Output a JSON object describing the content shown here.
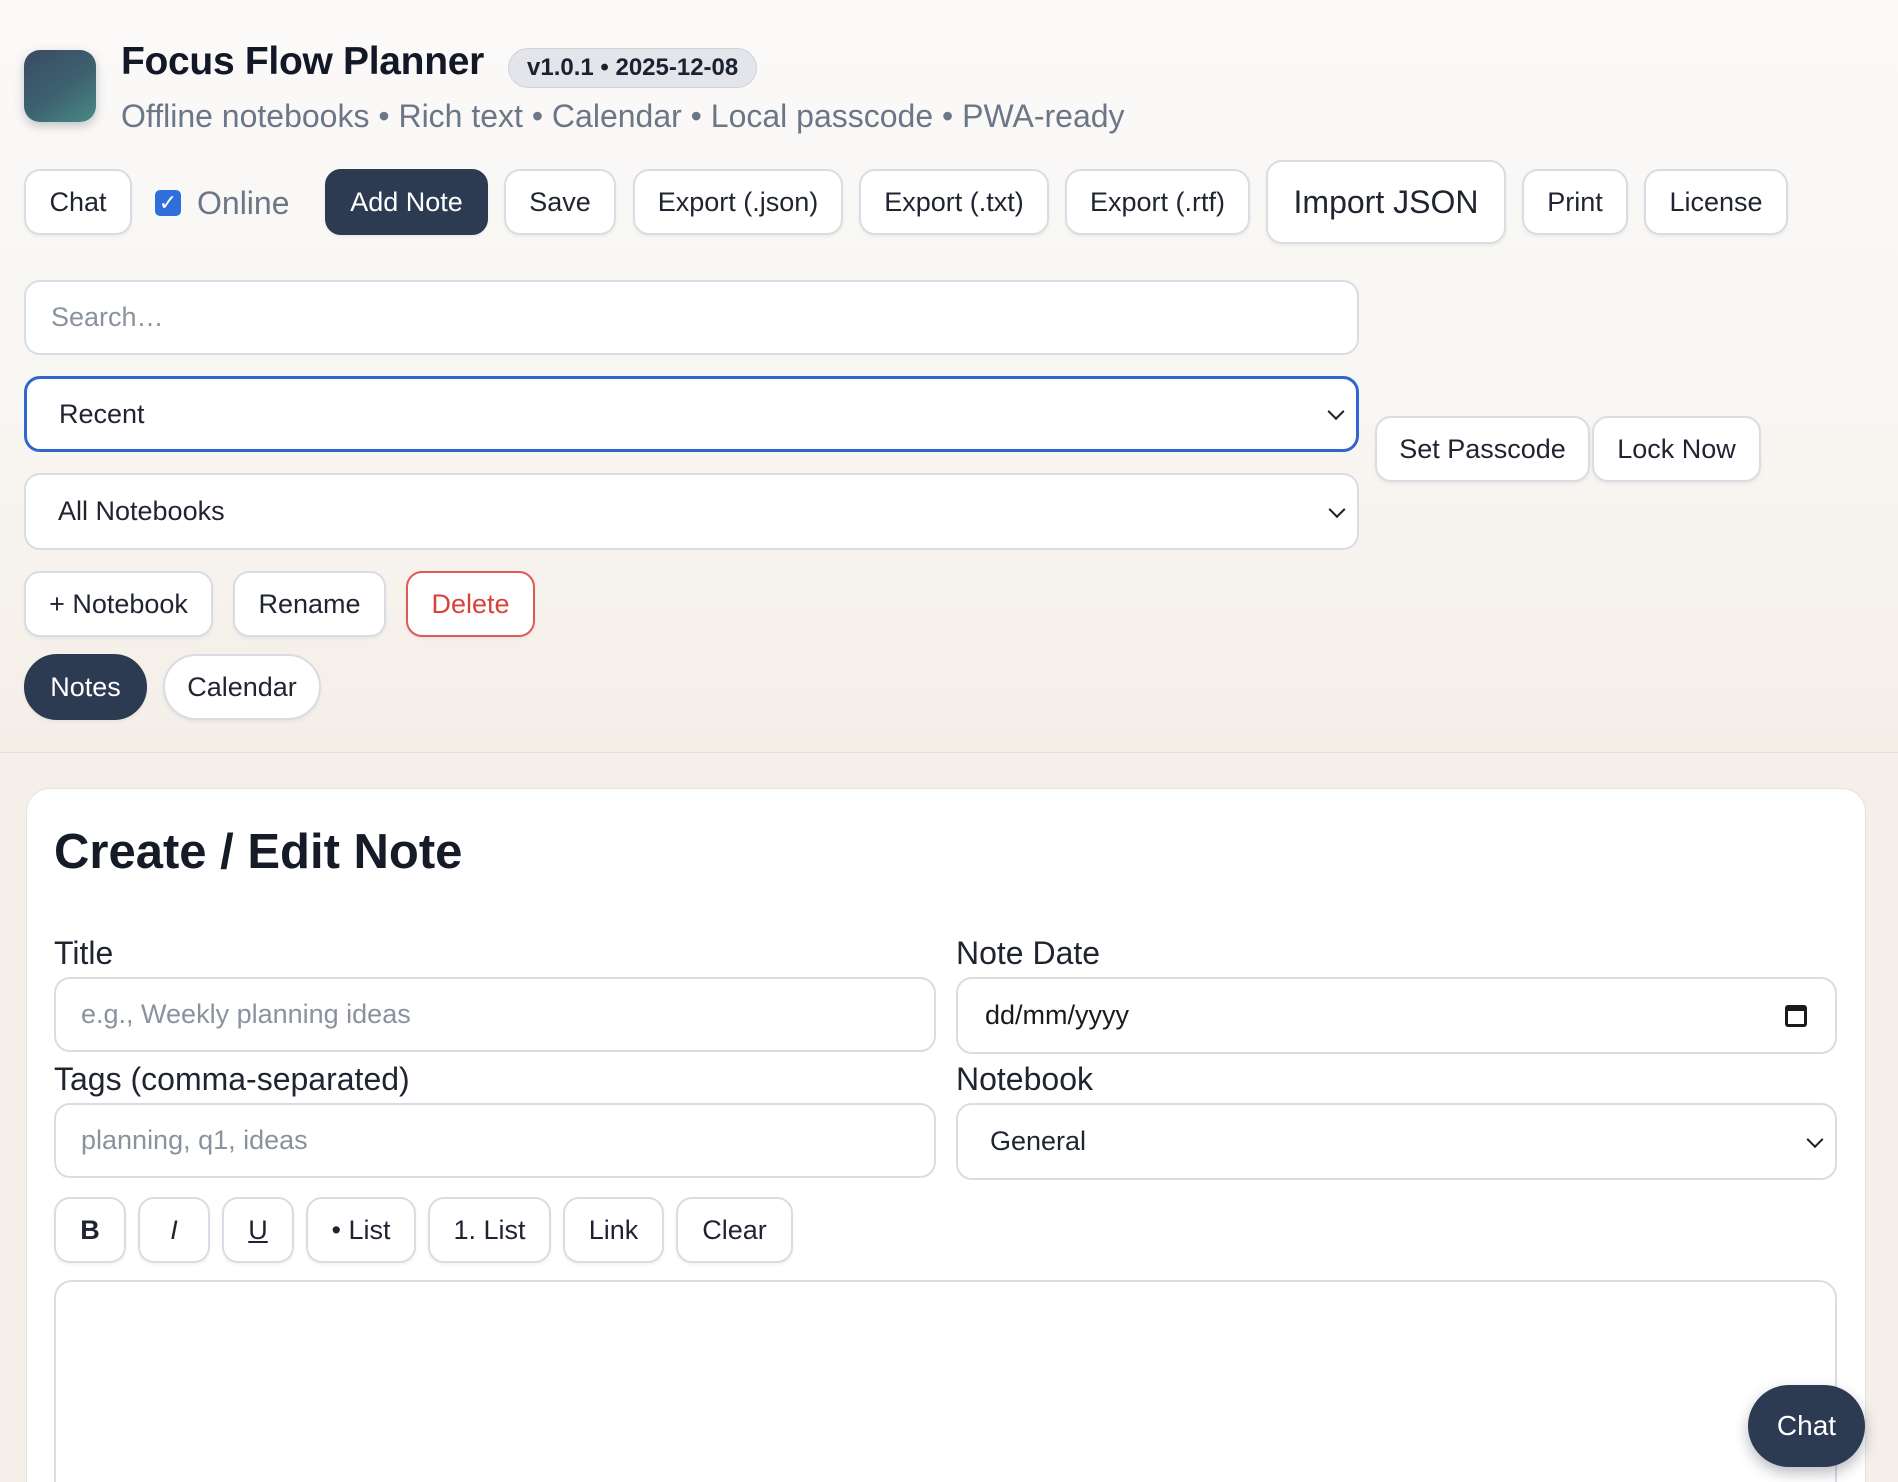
{
  "header": {
    "app_title": "Focus Flow Planner",
    "version": "v1.0.1 • 2025-12-08",
    "subtitle": "Offline notebooks • Rich text • Calendar • Local passcode • PWA-ready"
  },
  "toolbar": {
    "chat": "Chat",
    "online_label": "Online",
    "online_checked": true,
    "add_note": "Add Note",
    "save": "Save",
    "export_json": "Export (.json)",
    "export_txt": "Export (.txt)",
    "export_rtf": "Export (.rtf)",
    "import_json": "Import JSON",
    "print": "Print",
    "license": "License"
  },
  "filters": {
    "search_placeholder": "Search…",
    "sort_selected": "Recent",
    "notebook_selected": "All Notebooks",
    "set_passcode": "Set Passcode",
    "lock_now": "Lock Now"
  },
  "notebook_actions": {
    "add": "+ Notebook",
    "rename": "Rename",
    "delete": "Delete"
  },
  "view_tabs": {
    "notes": "Notes",
    "calendar": "Calendar"
  },
  "editor_card": {
    "heading": "Create / Edit Note",
    "title_label": "Title",
    "title_placeholder": "e.g., Weekly planning ideas",
    "date_label": "Note Date",
    "date_placeholder": "dd/mm/yyyy",
    "tags_label": "Tags (comma-separated)",
    "tags_placeholder": "planning, q1, ideas",
    "notebook_label": "Notebook",
    "notebook_selected": "General",
    "format_buttons": {
      "bold": "B",
      "italic": "I",
      "underline": "U",
      "bullet_list": "• List",
      "numbered_list": "1. List",
      "link": "Link",
      "clear": "Clear"
    }
  },
  "floating": {
    "chat": "Chat"
  },
  "colors": {
    "primary_dark": "#2c3a52",
    "danger": "#d8423c",
    "focus_blue": "#2f66d0"
  }
}
